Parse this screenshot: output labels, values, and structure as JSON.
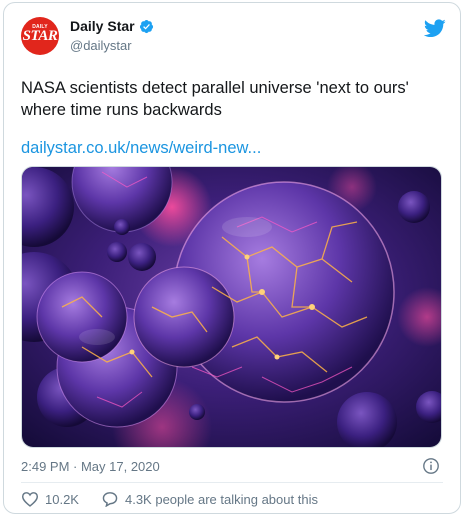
{
  "account": {
    "display_name": "Daily Star",
    "handle": "@dailystar",
    "logo_top": "DAILY",
    "logo_main": "STAR",
    "verified_icon": "verified-badge-icon"
  },
  "tweet": {
    "text": "NASA scientists detect parallel universe 'next to ours' where time runs backwards",
    "link": "dailystar.co.uk/news/weird-new...",
    "timestamp": "2:49 PM · May 17, 2020"
  },
  "actions": {
    "likes": "10.2K",
    "talking": "4.3K people are talking about this"
  },
  "colors": {
    "brand_red": "#e1261c",
    "twitter_blue": "#1da1f2",
    "link_blue": "#1b95e0",
    "muted": "#657786"
  }
}
